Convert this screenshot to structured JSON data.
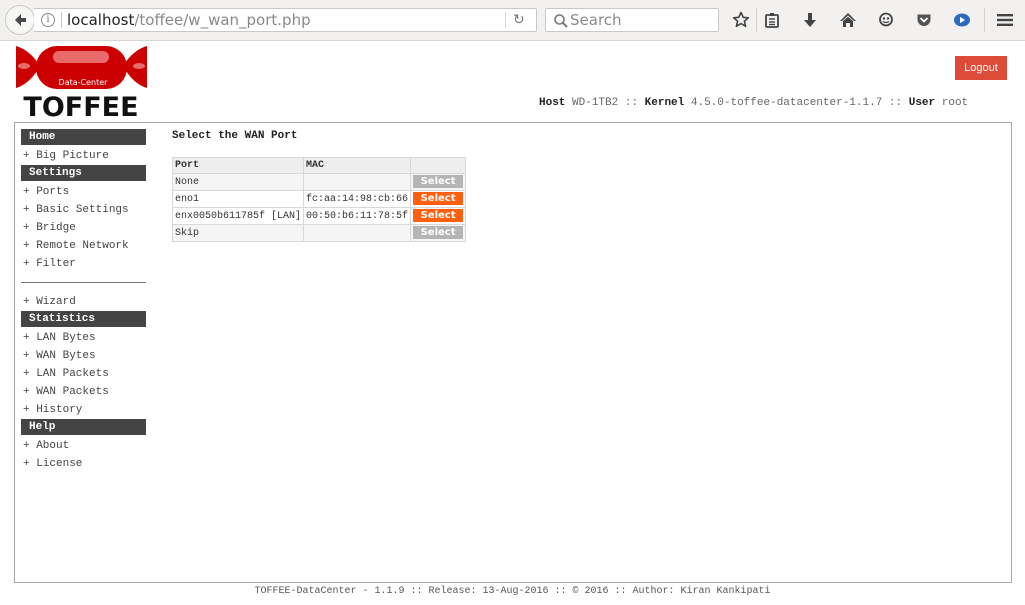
{
  "browser": {
    "url_host": "localhost",
    "url_path": "/toffee/w_wan_port.php",
    "search_placeholder": "Search",
    "toolbar_icons": [
      "star-icon",
      "reading-list-icon",
      "download-icon",
      "home-icon",
      "chat-icon",
      "pocket-icon",
      "media-icon",
      "menu-icon"
    ]
  },
  "header": {
    "logo_subtitle": "Data-Center",
    "logo_title": "TOFFEE",
    "logout_label": "Logout",
    "host_label": "Host",
    "host_value": "WD-1TB2",
    "kernel_label": "Kernel",
    "kernel_value": "4.5.0-toffee-datacenter-1.1.7",
    "user_label": "User",
    "user_value": "root",
    "separator": "::"
  },
  "sidebar": {
    "sections": [
      {
        "heading": "Home",
        "items": [
          "+ Big Picture"
        ]
      },
      {
        "heading": "Settings",
        "items": [
          "+ Ports",
          "+ Basic Settings",
          "+ Bridge",
          "+ Remote Network",
          "+ Filter"
        ]
      },
      {
        "heading": null,
        "items": [
          "+ Wizard"
        ]
      },
      {
        "heading": "Statistics",
        "items": [
          "+ LAN Bytes",
          "+ WAN Bytes",
          "+ LAN Packets",
          "+ WAN Packets",
          "+ History"
        ]
      },
      {
        "heading": "Help",
        "items": [
          "+ About",
          "+ License"
        ]
      }
    ]
  },
  "main": {
    "title": "Select the WAN Port",
    "table": {
      "columns": [
        "Port",
        "MAC",
        ""
      ],
      "rows": [
        {
          "port": "None",
          "mac": "",
          "button": "Select",
          "enabled": false
        },
        {
          "port": "eno1",
          "mac": "fc:aa:14:98:cb:66",
          "button": "Select",
          "enabled": true
        },
        {
          "port": "enx0050b611785f [LAN]",
          "mac": "00:50:b6:11:78:5f",
          "button": "Select",
          "enabled": true
        },
        {
          "port": "Skip",
          "mac": "",
          "button": "Select",
          "enabled": false
        }
      ]
    }
  },
  "footer": {
    "text": "TOFFEE-DataCenter - 1.1.9 :: Release: 13-Aug-2016 :: © 2016 :: Author: Kiran Kankipati"
  },
  "colors": {
    "logout": "#dd4b39",
    "select_active": "#ff6010",
    "select_disabled": "#b5b5b5",
    "sidebar_heading": "#444444",
    "logo_red": "#cc0000"
  }
}
